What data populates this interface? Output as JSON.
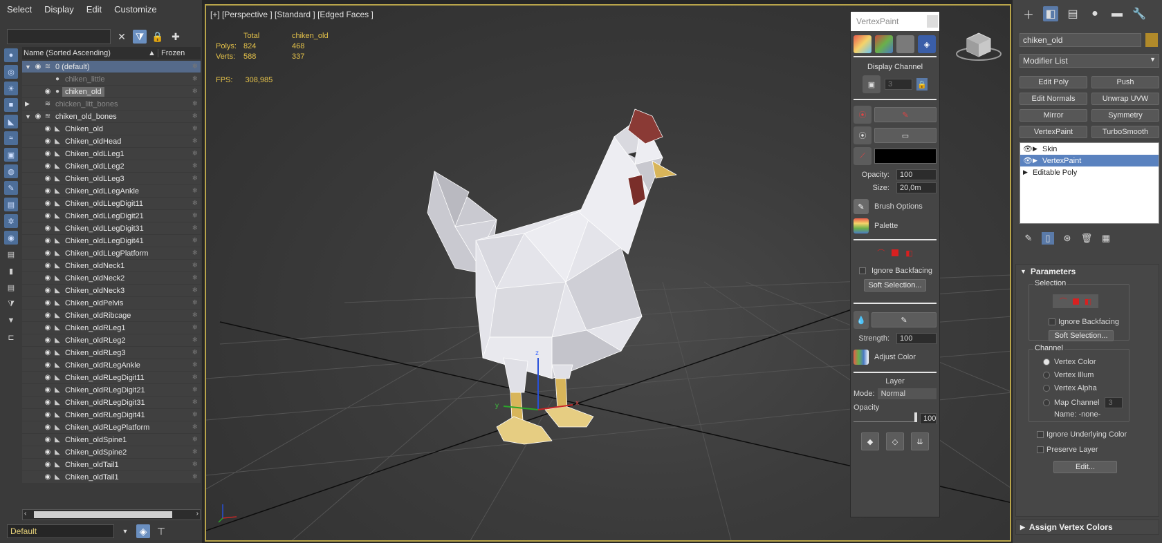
{
  "menu": [
    "Select",
    "Display",
    "Edit",
    "Customize"
  ],
  "explorer": {
    "search_value": "",
    "col_name": "Name (Sorted Ascending)",
    "col_frozen": "Frozen",
    "rows": [
      {
        "label": "0 (default)",
        "level": 0,
        "kind": "layer",
        "sel": true
      },
      {
        "label": "chiken_little",
        "level": 1,
        "kind": "obj",
        "dim": true
      },
      {
        "label": "chiken_old",
        "level": 1,
        "kind": "obj",
        "hl": true
      },
      {
        "label": "chicken_litt_bones",
        "level": 0,
        "kind": "layer",
        "dim": true
      },
      {
        "label": "chiken_old_bones",
        "level": 0,
        "kind": "layer"
      },
      {
        "label": "Chiken_old",
        "level": 1,
        "kind": "bone"
      },
      {
        "label": "Chiken_oldHead",
        "level": 1,
        "kind": "bone"
      },
      {
        "label": "Chiken_oldLLeg1",
        "level": 1,
        "kind": "bone"
      },
      {
        "label": "Chiken_oldLLeg2",
        "level": 1,
        "kind": "bone"
      },
      {
        "label": "Chiken_oldLLeg3",
        "level": 1,
        "kind": "bone"
      },
      {
        "label": "Chiken_oldLLegAnkle",
        "level": 1,
        "kind": "bone"
      },
      {
        "label": "Chiken_oldLLegDigit11",
        "level": 1,
        "kind": "bone"
      },
      {
        "label": "Chiken_oldLLegDigit21",
        "level": 1,
        "kind": "bone"
      },
      {
        "label": "Chiken_oldLLegDigit31",
        "level": 1,
        "kind": "bone"
      },
      {
        "label": "Chiken_oldLLegDigit41",
        "level": 1,
        "kind": "bone"
      },
      {
        "label": "Chiken_oldLLegPlatform",
        "level": 1,
        "kind": "bone"
      },
      {
        "label": "Chiken_oldNeck1",
        "level": 1,
        "kind": "bone"
      },
      {
        "label": "Chiken_oldNeck2",
        "level": 1,
        "kind": "bone"
      },
      {
        "label": "Chiken_oldNeck3",
        "level": 1,
        "kind": "bone"
      },
      {
        "label": "Chiken_oldPelvis",
        "level": 1,
        "kind": "bone"
      },
      {
        "label": "Chiken_oldRibcage",
        "level": 1,
        "kind": "bone"
      },
      {
        "label": "Chiken_oldRLeg1",
        "level": 1,
        "kind": "bone"
      },
      {
        "label": "Chiken_oldRLeg2",
        "level": 1,
        "kind": "bone"
      },
      {
        "label": "Chiken_oldRLeg3",
        "level": 1,
        "kind": "bone"
      },
      {
        "label": "Chiken_oldRLegAnkle",
        "level": 1,
        "kind": "bone"
      },
      {
        "label": "Chiken_oldRLegDigit11",
        "level": 1,
        "kind": "bone"
      },
      {
        "label": "Chiken_oldRLegDigit21",
        "level": 1,
        "kind": "bone"
      },
      {
        "label": "Chiken_oldRLegDigit31",
        "level": 1,
        "kind": "bone"
      },
      {
        "label": "Chiken_oldRLegDigit41",
        "level": 1,
        "kind": "bone"
      },
      {
        "label": "Chiken_oldRLegPlatform",
        "level": 1,
        "kind": "bone"
      },
      {
        "label": "Chiken_oldSpine1",
        "level": 1,
        "kind": "bone"
      },
      {
        "label": "Chiken_oldSpine2",
        "level": 1,
        "kind": "bone"
      },
      {
        "label": "Chiken_oldTail1",
        "level": 1,
        "kind": "bone"
      },
      {
        "label": "Chiken_oldTail1",
        "level": 1,
        "kind": "bone"
      }
    ],
    "layer_value": "Default"
  },
  "viewport": {
    "label": "[+] [Perspective ] [Standard ] [Edged Faces ]",
    "stats": {
      "h_total": "Total",
      "h_obj": "chiken_old",
      "polys_label": "Polys:",
      "polys_total": "824",
      "polys_obj": "468",
      "verts_label": "Verts:",
      "verts_total": "588",
      "verts_obj": "337"
    },
    "fps_label": "FPS:",
    "fps_value": "308,985",
    "colors": {
      "stats": "#e6c34a",
      "border": "#b8a44a",
      "mesh": "#e9e9ef",
      "comb": "#8a3a35",
      "beak": "#d8b55a"
    }
  },
  "vertexpaint": {
    "title": "VertexPaint",
    "display_channel": "Display Channel",
    "channel_value": "3",
    "opacity_label": "Opacity:",
    "opacity_value": "100",
    "size_label": "Size:",
    "size_value": "20,0m",
    "brush_options": "Brush Options",
    "palette": "Palette",
    "ignore_backfacing": "Ignore Backfacing",
    "soft_selection": "Soft Selection...",
    "strength_label": "Strength:",
    "strength_value": "100",
    "adjust_color": "Adjust Color",
    "layer_title": "Layer",
    "mode_label": "Mode:",
    "mode_value": "Normal",
    "layer_opacity_label": "Opacity",
    "layer_opacity_value": "100"
  },
  "panel": {
    "object_name": "chiken_old",
    "modifier_list": "Modifier List",
    "mod_buttons": [
      "Edit Poly",
      "Push",
      "Edit Normals",
      "Unwrap UVW",
      "Mirror",
      "Symmetry",
      "VertexPaint",
      "TurboSmooth"
    ],
    "stack": [
      "Skin",
      "VertexPaint",
      "Editable Poly"
    ],
    "params_title": "Parameters",
    "selection_title": "Selection",
    "ignore_backfacing": "Ignore Backfacing",
    "soft_selection": "Soft Selection...",
    "channel_title": "Channel",
    "channels": [
      "Vertex Color",
      "Vertex Illum",
      "Vertex Alpha",
      "Map Channel"
    ],
    "map_channel_value": "3",
    "name_label": "Name: -none-",
    "ignore_underlying": "Ignore Underlying Color",
    "preserve_layer": "Preserve Layer",
    "edit_button": "Edit...",
    "assign_title": "Assign Vertex Colors"
  }
}
